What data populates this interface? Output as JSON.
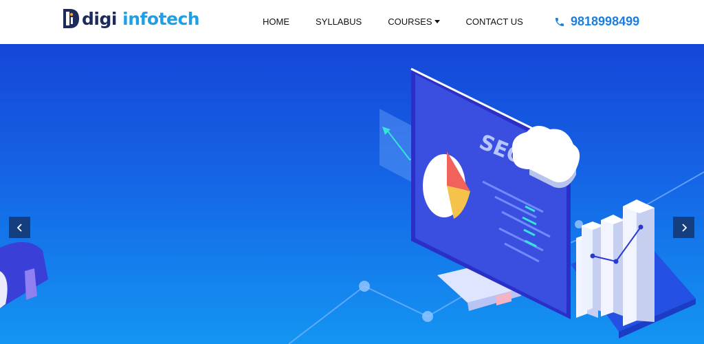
{
  "brand": {
    "name_part1": "digi",
    "name_part2": "infotech",
    "colors": {
      "dark": "#1c2b5a",
      "light": "#1ea0e6"
    }
  },
  "nav": {
    "items": [
      {
        "label": "HOME"
      },
      {
        "label": "SYLLABUS"
      },
      {
        "label": "COURSES"
      },
      {
        "label": "CONTACT US"
      }
    ]
  },
  "contact": {
    "phone": "9818998499",
    "icon": "phone-icon",
    "color": "#1a7fe0"
  },
  "hero": {
    "illustration_text": "SEO",
    "prev_icon": "chevron-left-icon",
    "next_icon": "chevron-right-icon",
    "control_color": "#143e7e"
  }
}
